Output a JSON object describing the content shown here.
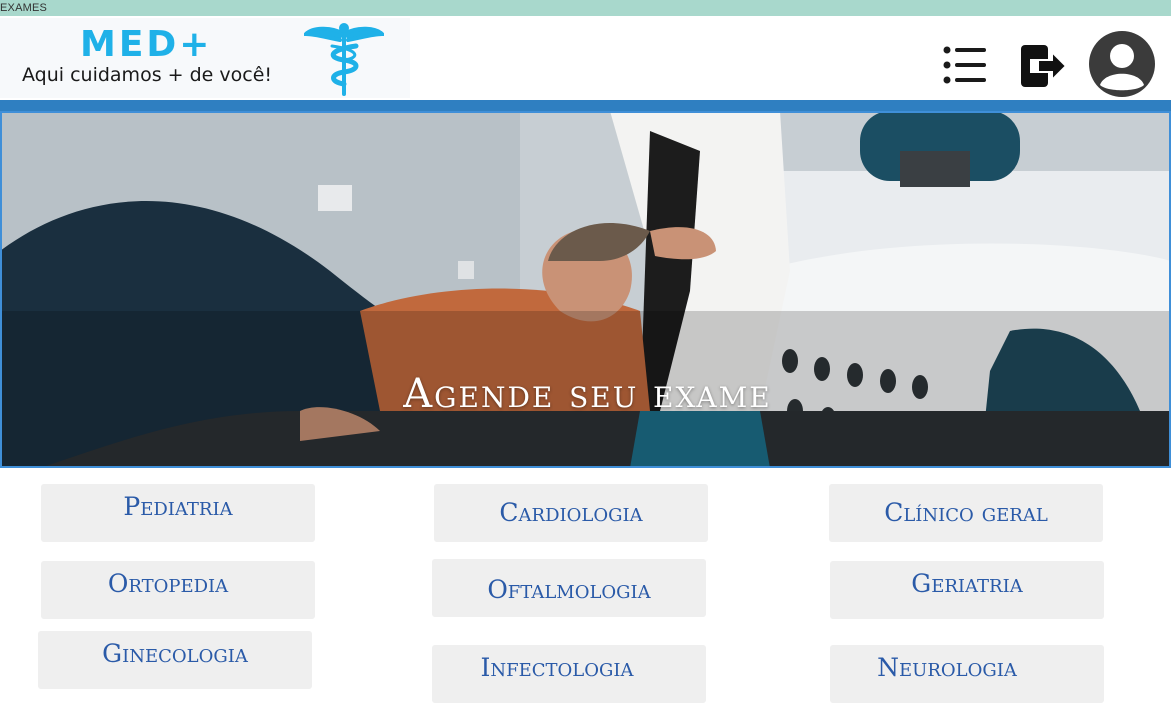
{
  "tab": {
    "title": "EXAMES"
  },
  "header": {
    "logo": {
      "name": "MED+",
      "tagline": "Aqui cuidamos + de você!",
      "symbol": "caduceus-icon"
    },
    "icons": {
      "menu": "list-icon",
      "logout": "logout-icon",
      "user": "user-circle-icon"
    }
  },
  "hero": {
    "title": "Agende seu exame"
  },
  "specialties": [
    "Pediatria",
    "Cardiologia",
    "Clínico geral",
    "Ortopedia",
    "Oftalmologia",
    "Geriatria",
    "Ginecologia",
    "Infectologia",
    "Neurologia"
  ],
  "colors": {
    "tabbar": "#a8d8cc",
    "divider": "#2f7fc1",
    "brand": "#1fb1e8",
    "button_bg": "#efefef",
    "button_text": "#2a5aa8"
  }
}
